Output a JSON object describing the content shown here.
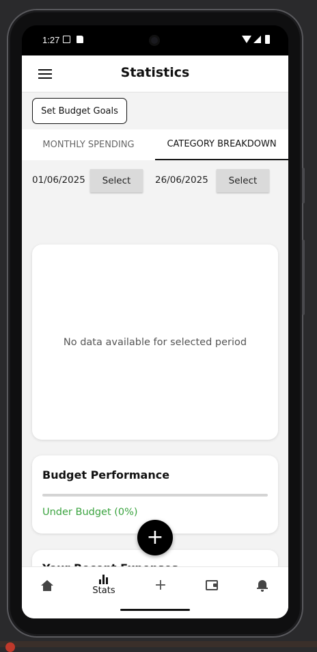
{
  "status_bar": {
    "time": "1:27"
  },
  "header": {
    "title": "Statistics"
  },
  "actions": {
    "budget_goals_label": "Set Budget Goals"
  },
  "tabs": [
    {
      "label": "MONTHLY SPENDING",
      "active": false
    },
    {
      "label": "CATEGORY BREAKDOWN",
      "active": true
    }
  ],
  "date_range": {
    "start_date": "01/06/2025",
    "end_date": "26/06/2025",
    "select_label": "Select"
  },
  "chart_card": {
    "empty_message": "No data available for selected period"
  },
  "budget_performance": {
    "title": "Budget Performance",
    "status": "Under Budget (0%)",
    "progress_fraction": 0.0,
    "status_color": "#3aa33f"
  },
  "next_card": {
    "title_partial": "Your Recent Expenses"
  },
  "fab": {
    "label": "+"
  },
  "bottom_nav": [
    {
      "icon": "home-icon",
      "label": ""
    },
    {
      "icon": "stats-icon",
      "label": "Stats",
      "active": true
    },
    {
      "icon": "add-icon",
      "label": ""
    },
    {
      "icon": "wallet-icon",
      "label": ""
    },
    {
      "icon": "notification-bell-icon",
      "label": ""
    }
  ]
}
